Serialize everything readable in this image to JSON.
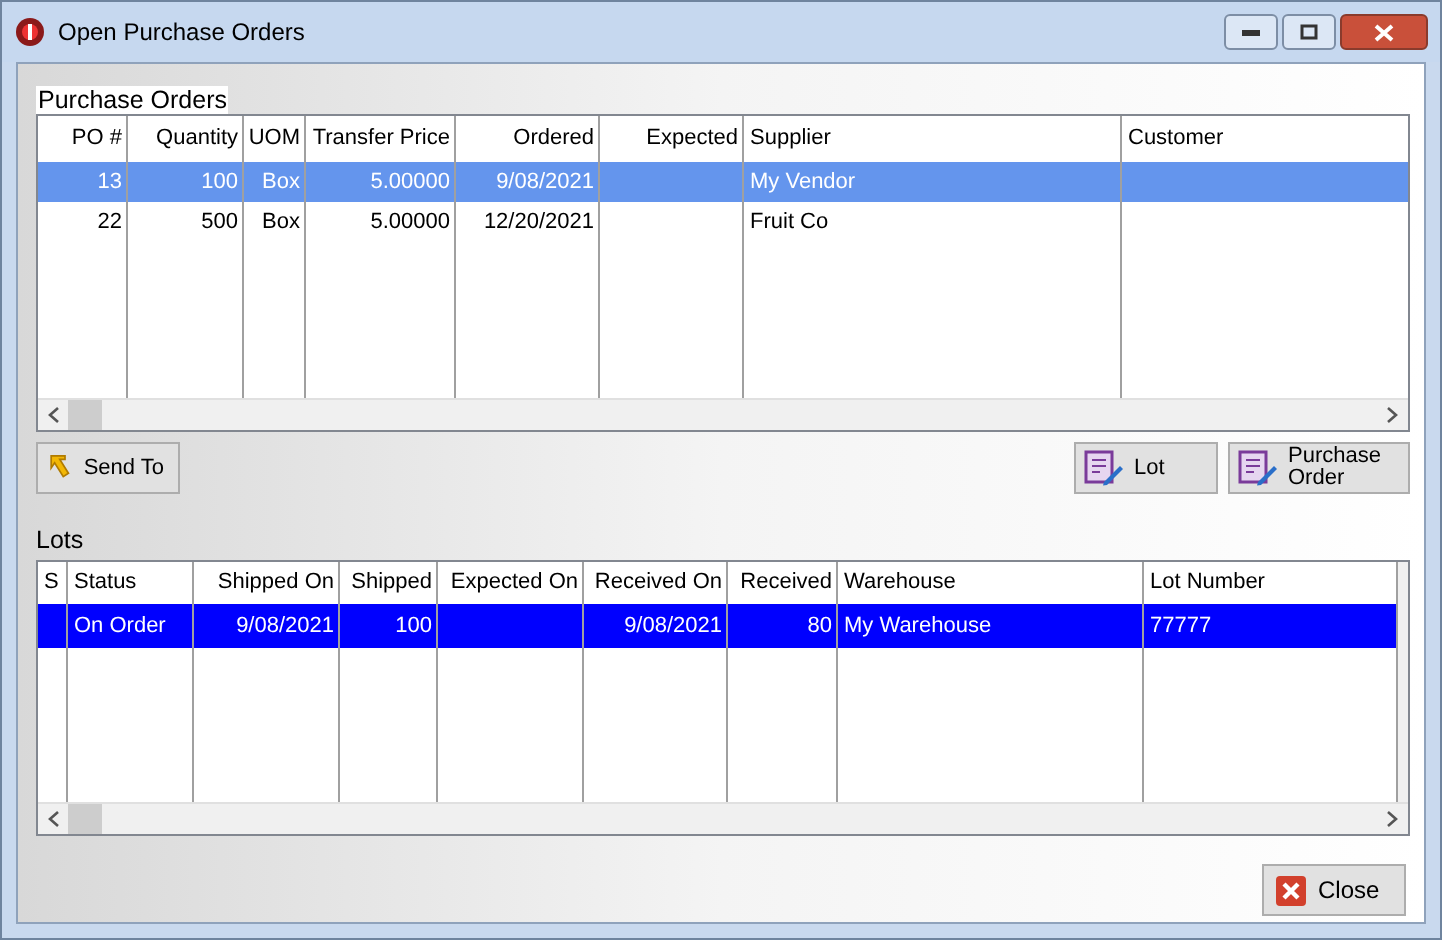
{
  "window": {
    "title": "Open Purchase Orders"
  },
  "purchase_orders": {
    "label": "Purchase Orders",
    "columns": [
      "PO #",
      "Quantity",
      "UOM",
      "Transfer Price",
      "Ordered",
      "Expected",
      "Supplier",
      "Customer"
    ],
    "rows": [
      {
        "selected": true,
        "cells": [
          "13",
          "100",
          "Box",
          "5.00000",
          "9/08/2021",
          "",
          "My Vendor",
          ""
        ]
      },
      {
        "selected": false,
        "cells": [
          "22",
          "500",
          "Box",
          "5.00000",
          "12/20/2021",
          "",
          "Fruit Co",
          ""
        ]
      }
    ]
  },
  "po_buttons": [
    {
      "label": "Send To",
      "kind": "send"
    },
    {
      "label": "Lot",
      "kind": "doc"
    },
    {
      "label": "Purchase Order",
      "kind": "doc"
    }
  ],
  "lots": {
    "label": "Lots",
    "columns": [
      "S",
      "Status",
      "Shipped On",
      "Shipped",
      "Expected On",
      "Received On",
      "Received",
      "Warehouse",
      "Lot Number"
    ],
    "rows": [
      {
        "selected": true,
        "cells": [
          "",
          "On Order",
          "9/08/2021",
          "100",
          "",
          "9/08/2021",
          "80",
          "My Warehouse",
          "77777"
        ]
      }
    ]
  },
  "close_button": {
    "label": "Close"
  }
}
